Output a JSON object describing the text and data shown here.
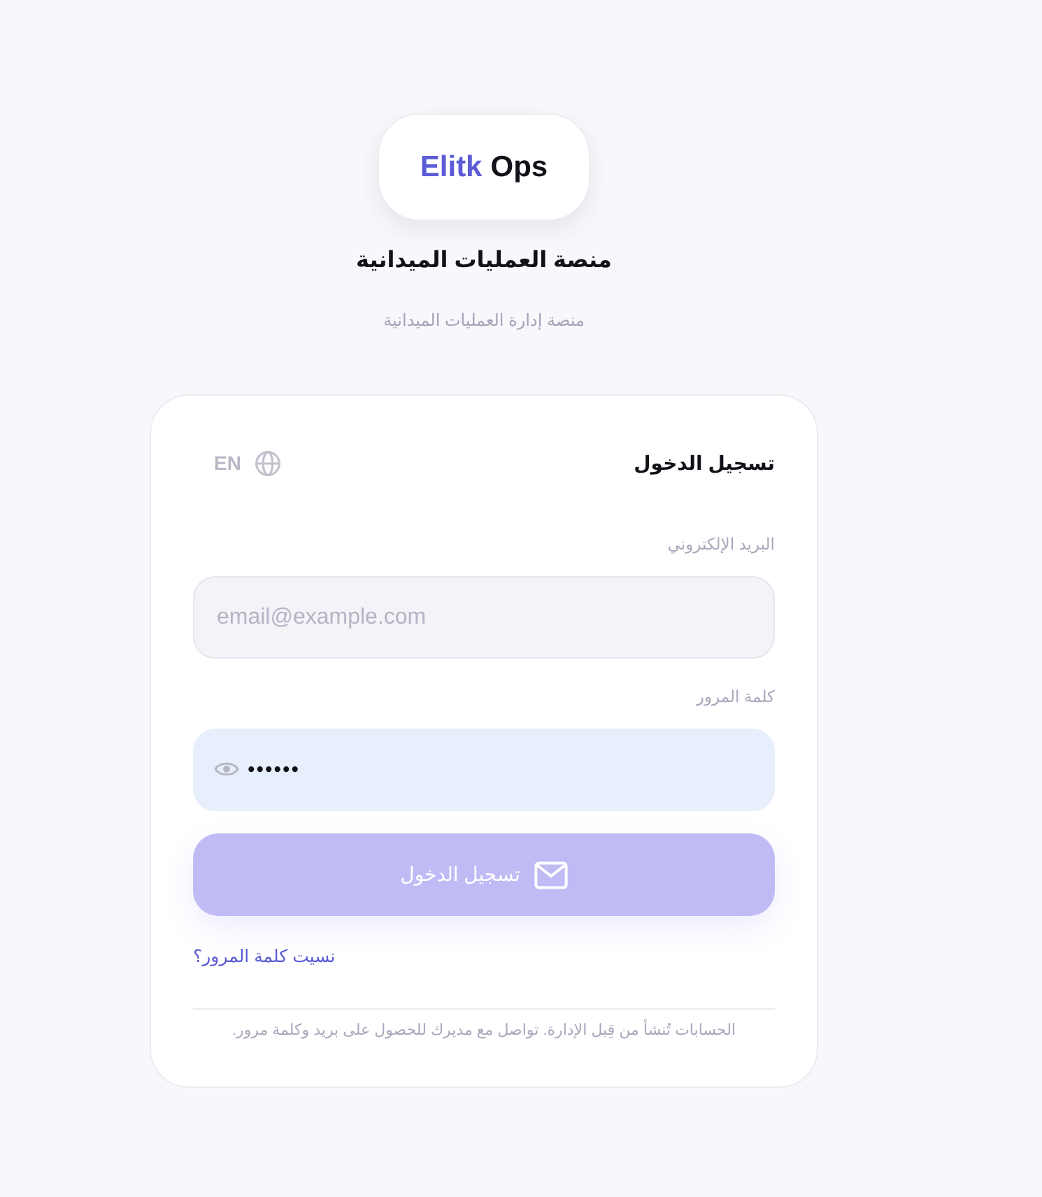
{
  "logo": {
    "text_primary": "Elitk",
    "text_secondary": "Ops"
  },
  "title": "منصة العمليات الميدانية",
  "subtitle": "منصة إدارة العمليات الميدانية",
  "card": {
    "heading": "تسجيل الدخول",
    "language_toggle": {
      "label": "EN"
    },
    "fields": [
      {
        "kind": "email",
        "label": "البريد الإلكتروني",
        "placeholder": "email@example.com",
        "autofilled": false
      },
      {
        "kind": "password",
        "label": "كلمة المرور",
        "value": "••••••",
        "autofilled": true
      }
    ],
    "submit_button": {
      "label": "تسجيل الدخول",
      "disabled": true
    },
    "forgot_link": "نسيت كلمة المرور؟",
    "note": "الحسابات تُنشأ من قِبل الإدارة. تواصل مع مديرك للحصول على بريد وكلمة مرور."
  }
}
